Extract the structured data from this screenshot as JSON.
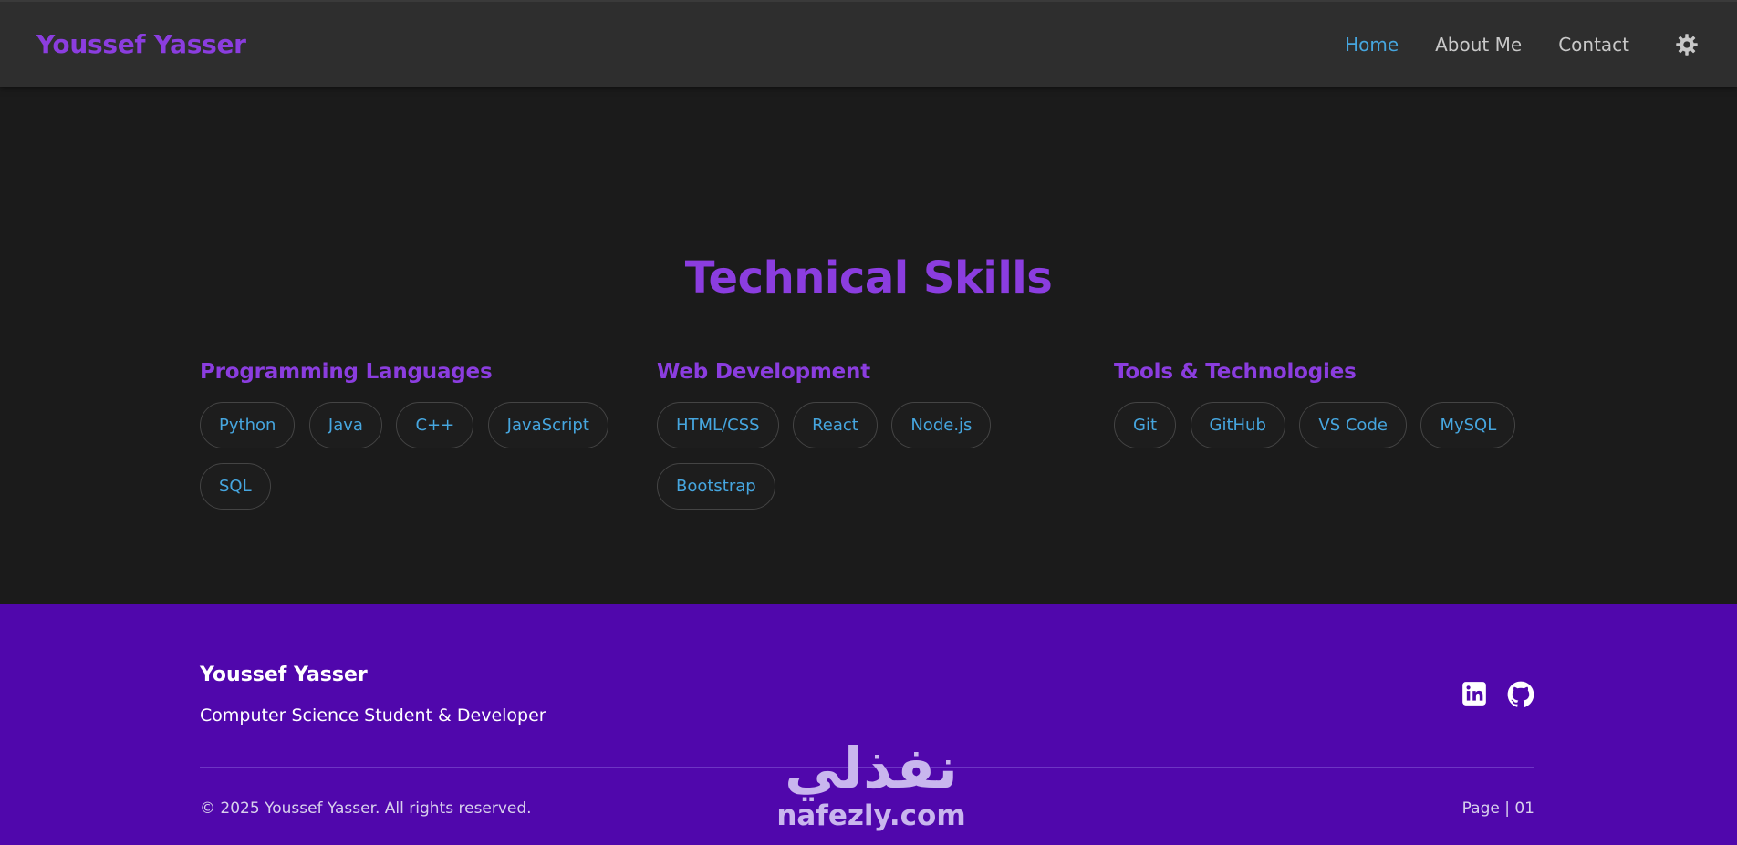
{
  "navbar": {
    "brand": "Youssef Yasser",
    "links": [
      {
        "label": "Home",
        "active": true
      },
      {
        "label": "About Me",
        "active": false
      },
      {
        "label": "Contact",
        "active": false
      }
    ],
    "theme_toggle_icon": "gear-icon"
  },
  "skills": {
    "title": "Technical Skills",
    "categories": [
      {
        "title": "Programming Languages",
        "items": [
          "Python",
          "Java",
          "C++",
          "JavaScript",
          "SQL"
        ]
      },
      {
        "title": "Web Development",
        "items": [
          "HTML/CSS",
          "React",
          "Node.js",
          "Bootstrap"
        ]
      },
      {
        "title": "Tools & Technologies",
        "items": [
          "Git",
          "GitHub",
          "VS Code",
          "MySQL"
        ]
      }
    ]
  },
  "footer": {
    "name": "Youssef Yasser",
    "tagline": "Computer Science Student & Developer",
    "social": [
      "linkedin-icon",
      "github-icon"
    ],
    "copyright": "© 2025 Youssef Yasser. All rights reserved.",
    "page_indicator": "Page | 01"
  },
  "watermark": {
    "arabic": "نفذلي",
    "latin": "nafezly.com"
  },
  "colors": {
    "accent_purple": "#8b3ddf",
    "link_blue": "#46a6df",
    "footer_bg": "#5007ac",
    "page_bg": "#1b1b1b",
    "navbar_bg": "#2e2e2e"
  }
}
